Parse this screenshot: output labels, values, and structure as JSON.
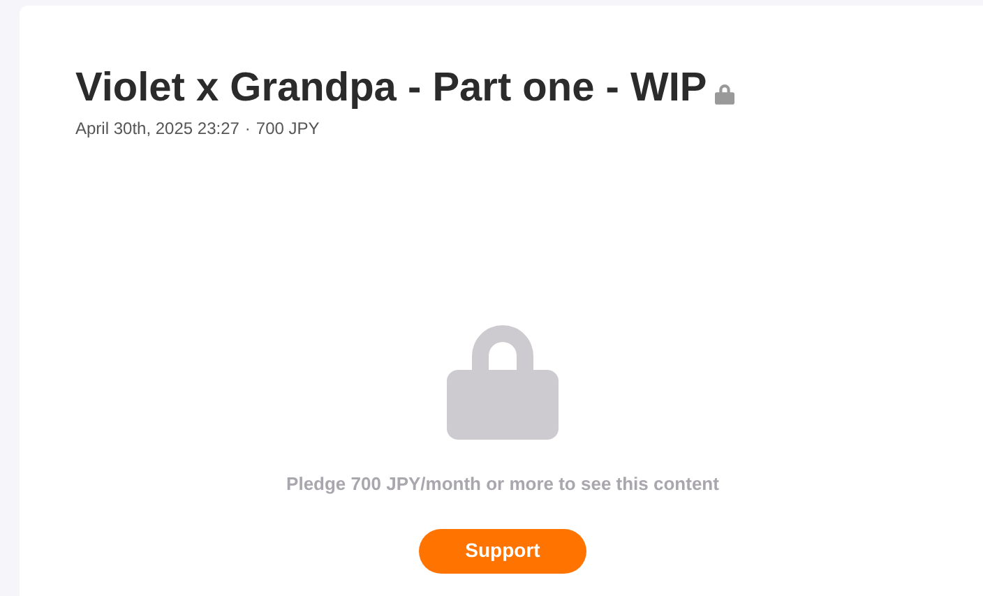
{
  "post": {
    "title": "Violet x Grandpa - Part one - WIP",
    "locked": true,
    "date": "April 30th, 2025 23:27",
    "separator": "·",
    "price": "700 JPY"
  },
  "paywall": {
    "message": "Pledge **700 JPY**/month or more to see this content",
    "button": "Support"
  }
}
